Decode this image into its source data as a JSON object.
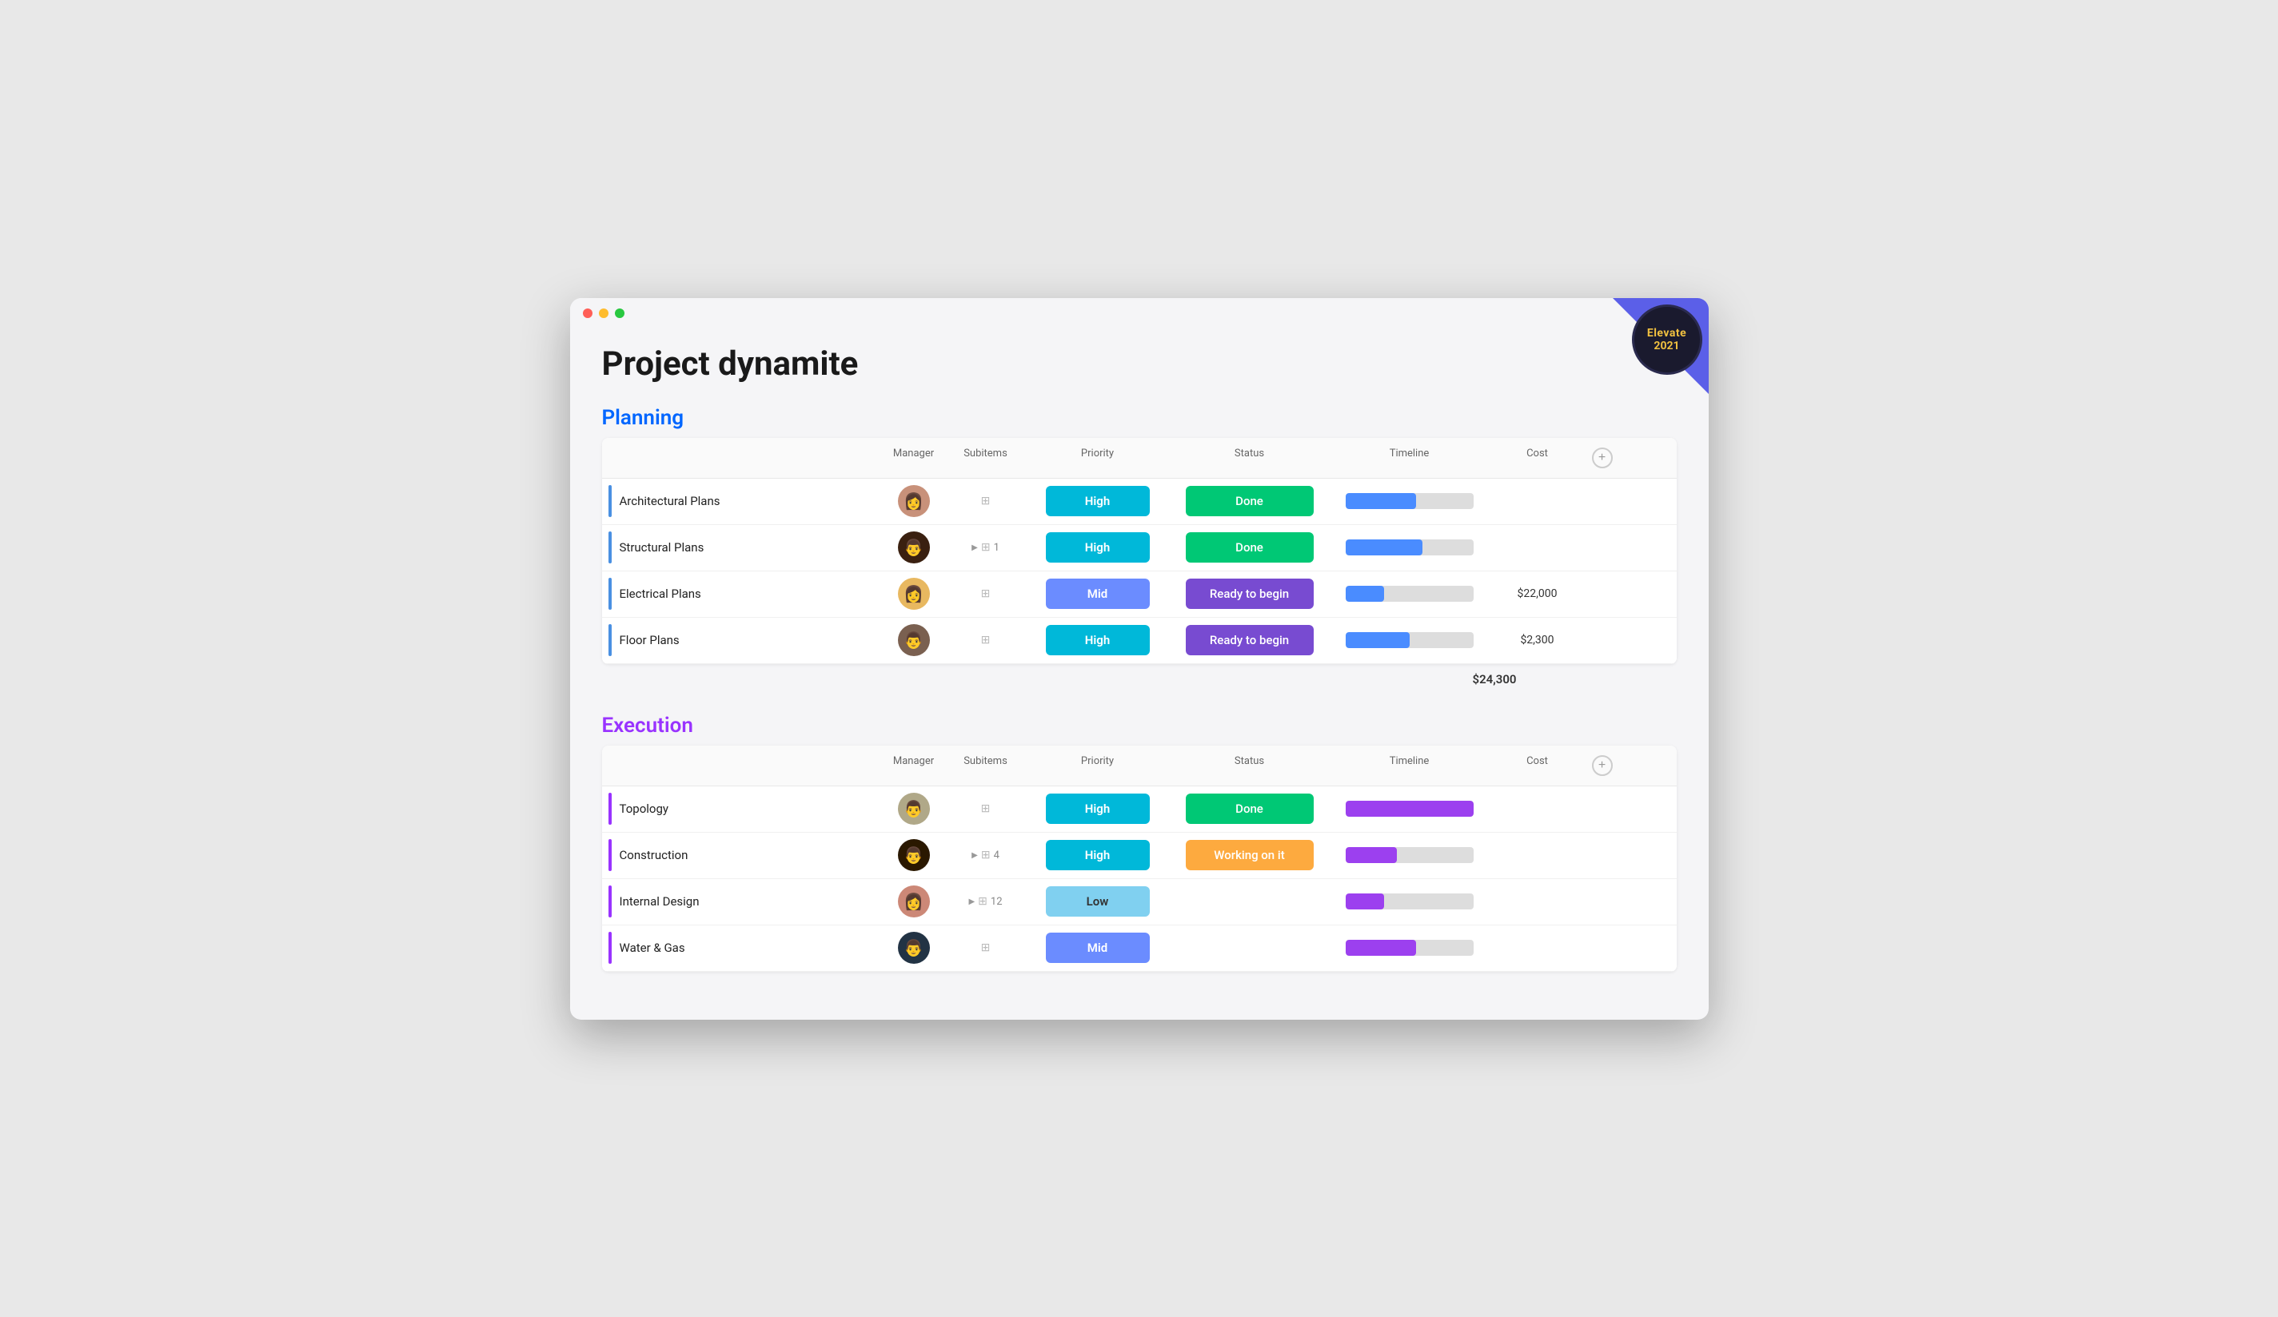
{
  "window": {
    "title": "Project dynamite"
  },
  "badge": {
    "line1": "Elevate",
    "line2": "2021"
  },
  "planning": {
    "section_title": "Planning",
    "col_manager": "Manager",
    "col_subitems": "Subitems",
    "col_priority": "Priority",
    "col_status": "Status",
    "col_timeline": "Timeline",
    "col_cost": "Cost",
    "total": "$24,300",
    "rows": [
      {
        "name": "Architectural Plans",
        "avatar_index": 0,
        "subitems_count": "",
        "has_expand": false,
        "priority": "High",
        "priority_class": "priority-high",
        "status": "Done",
        "status_class": "status-done",
        "timeline_pct": 55,
        "timeline_class": "timeline-blue",
        "cost": ""
      },
      {
        "name": "Structural Plans",
        "avatar_index": 1,
        "subitems_count": "1",
        "has_expand": true,
        "priority": "High",
        "priority_class": "priority-high",
        "status": "Done",
        "status_class": "status-done",
        "timeline_pct": 60,
        "timeline_class": "timeline-blue",
        "cost": ""
      },
      {
        "name": "Electrical Plans",
        "avatar_index": 2,
        "subitems_count": "",
        "has_expand": false,
        "priority": "Mid",
        "priority_class": "priority-mid",
        "status": "Ready to begin",
        "status_class": "status-ready",
        "timeline_pct": 30,
        "timeline_class": "timeline-blue",
        "cost": "$22,000"
      },
      {
        "name": "Floor Plans",
        "avatar_index": 3,
        "subitems_count": "",
        "has_expand": false,
        "priority": "High",
        "priority_class": "priority-high",
        "status": "Ready to begin",
        "status_class": "status-ready",
        "timeline_pct": 50,
        "timeline_class": "timeline-blue",
        "cost": "$2,300"
      }
    ]
  },
  "execution": {
    "section_title": "Execution",
    "col_manager": "Manager",
    "col_subitems": "Subitems",
    "col_priority": "Priority",
    "col_status": "Status",
    "col_timeline": "Timeline",
    "col_cost": "Cost",
    "rows": [
      {
        "name": "Topology",
        "avatar_index": 4,
        "subitems_count": "",
        "has_expand": false,
        "priority": "High",
        "priority_class": "priority-high",
        "status": "Done",
        "status_class": "status-done",
        "timeline_pct": 100,
        "timeline_class": "timeline-purple",
        "cost": ""
      },
      {
        "name": "Construction",
        "avatar_index": 5,
        "subitems_count": "4",
        "has_expand": true,
        "priority": "High",
        "priority_class": "priority-high",
        "status": "Working on it",
        "status_class": "status-working",
        "timeline_pct": 40,
        "timeline_class": "timeline-purple",
        "cost": ""
      },
      {
        "name": "Internal Design",
        "avatar_index": 6,
        "subitems_count": "12",
        "has_expand": true,
        "priority": "Low",
        "priority_class": "priority-low",
        "status": "",
        "status_class": "",
        "timeline_pct": 30,
        "timeline_class": "timeline-purple",
        "cost": ""
      },
      {
        "name": "Water & Gas",
        "avatar_index": 7,
        "subitems_count": "",
        "has_expand": false,
        "priority": "Mid",
        "priority_class": "priority-mid",
        "status": "",
        "status_class": "",
        "timeline_pct": 55,
        "timeline_class": "timeline-purple",
        "cost": ""
      }
    ]
  },
  "avatars": [
    {
      "bg": "#c8917a",
      "text": "👩"
    },
    {
      "bg": "#3a2010",
      "text": "👨"
    },
    {
      "bg": "#e8b860",
      "text": "👩"
    },
    {
      "bg": "#7a6050",
      "text": "👨"
    },
    {
      "bg": "#b0a888",
      "text": "👨"
    },
    {
      "bg": "#2a1800",
      "text": "👨"
    },
    {
      "bg": "#cc8877",
      "text": "👩"
    },
    {
      "bg": "#223344",
      "text": "👨"
    }
  ]
}
